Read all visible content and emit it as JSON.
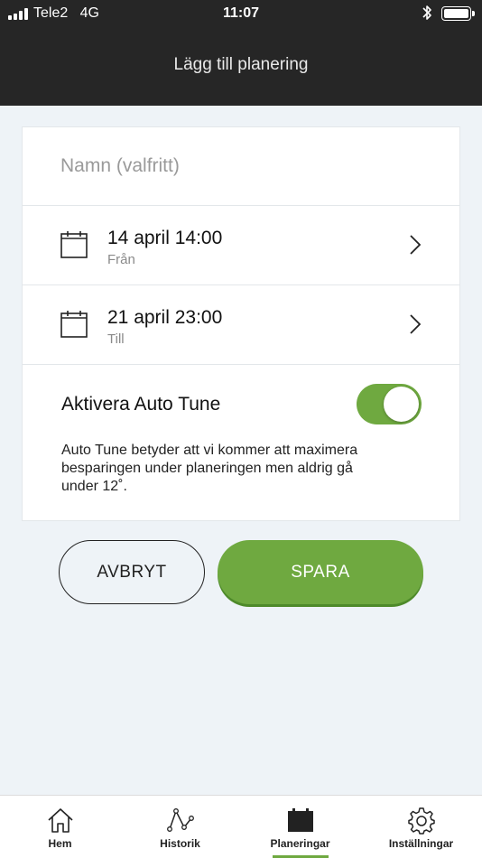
{
  "status_bar": {
    "carrier": "Tele2",
    "network": "4G",
    "time": "11:07",
    "icons": [
      "signal-icon",
      "bluetooth-icon",
      "battery-icon"
    ]
  },
  "header": {
    "title": "Lägg till planering"
  },
  "form": {
    "name_placeholder": "Namn (valfritt)",
    "name_value": "",
    "from": {
      "date": "14 april 14:00",
      "label": "Från"
    },
    "to": {
      "date": "21 april 23:00",
      "label": "Till"
    },
    "auto_tune": {
      "label": "Aktivera Auto Tune",
      "enabled": true,
      "description": "Auto Tune betyder att vi kommer att maximera besparingen under planeringen men aldrig gå under 12˚."
    }
  },
  "actions": {
    "cancel_label": "AVBRYT",
    "save_label": "SPARA"
  },
  "tabbar": {
    "tabs": [
      {
        "label": "Hem",
        "icon": "home-icon",
        "active": false
      },
      {
        "label": "Historik",
        "icon": "history-icon",
        "active": false
      },
      {
        "label": "Planeringar",
        "icon": "calendar-icon",
        "active": true
      },
      {
        "label": "Inställningar",
        "icon": "gear-icon",
        "active": false
      }
    ]
  },
  "colors": {
    "accent": "#6fa940",
    "header_bg": "#262626",
    "page_bg": "#eef3f7"
  }
}
